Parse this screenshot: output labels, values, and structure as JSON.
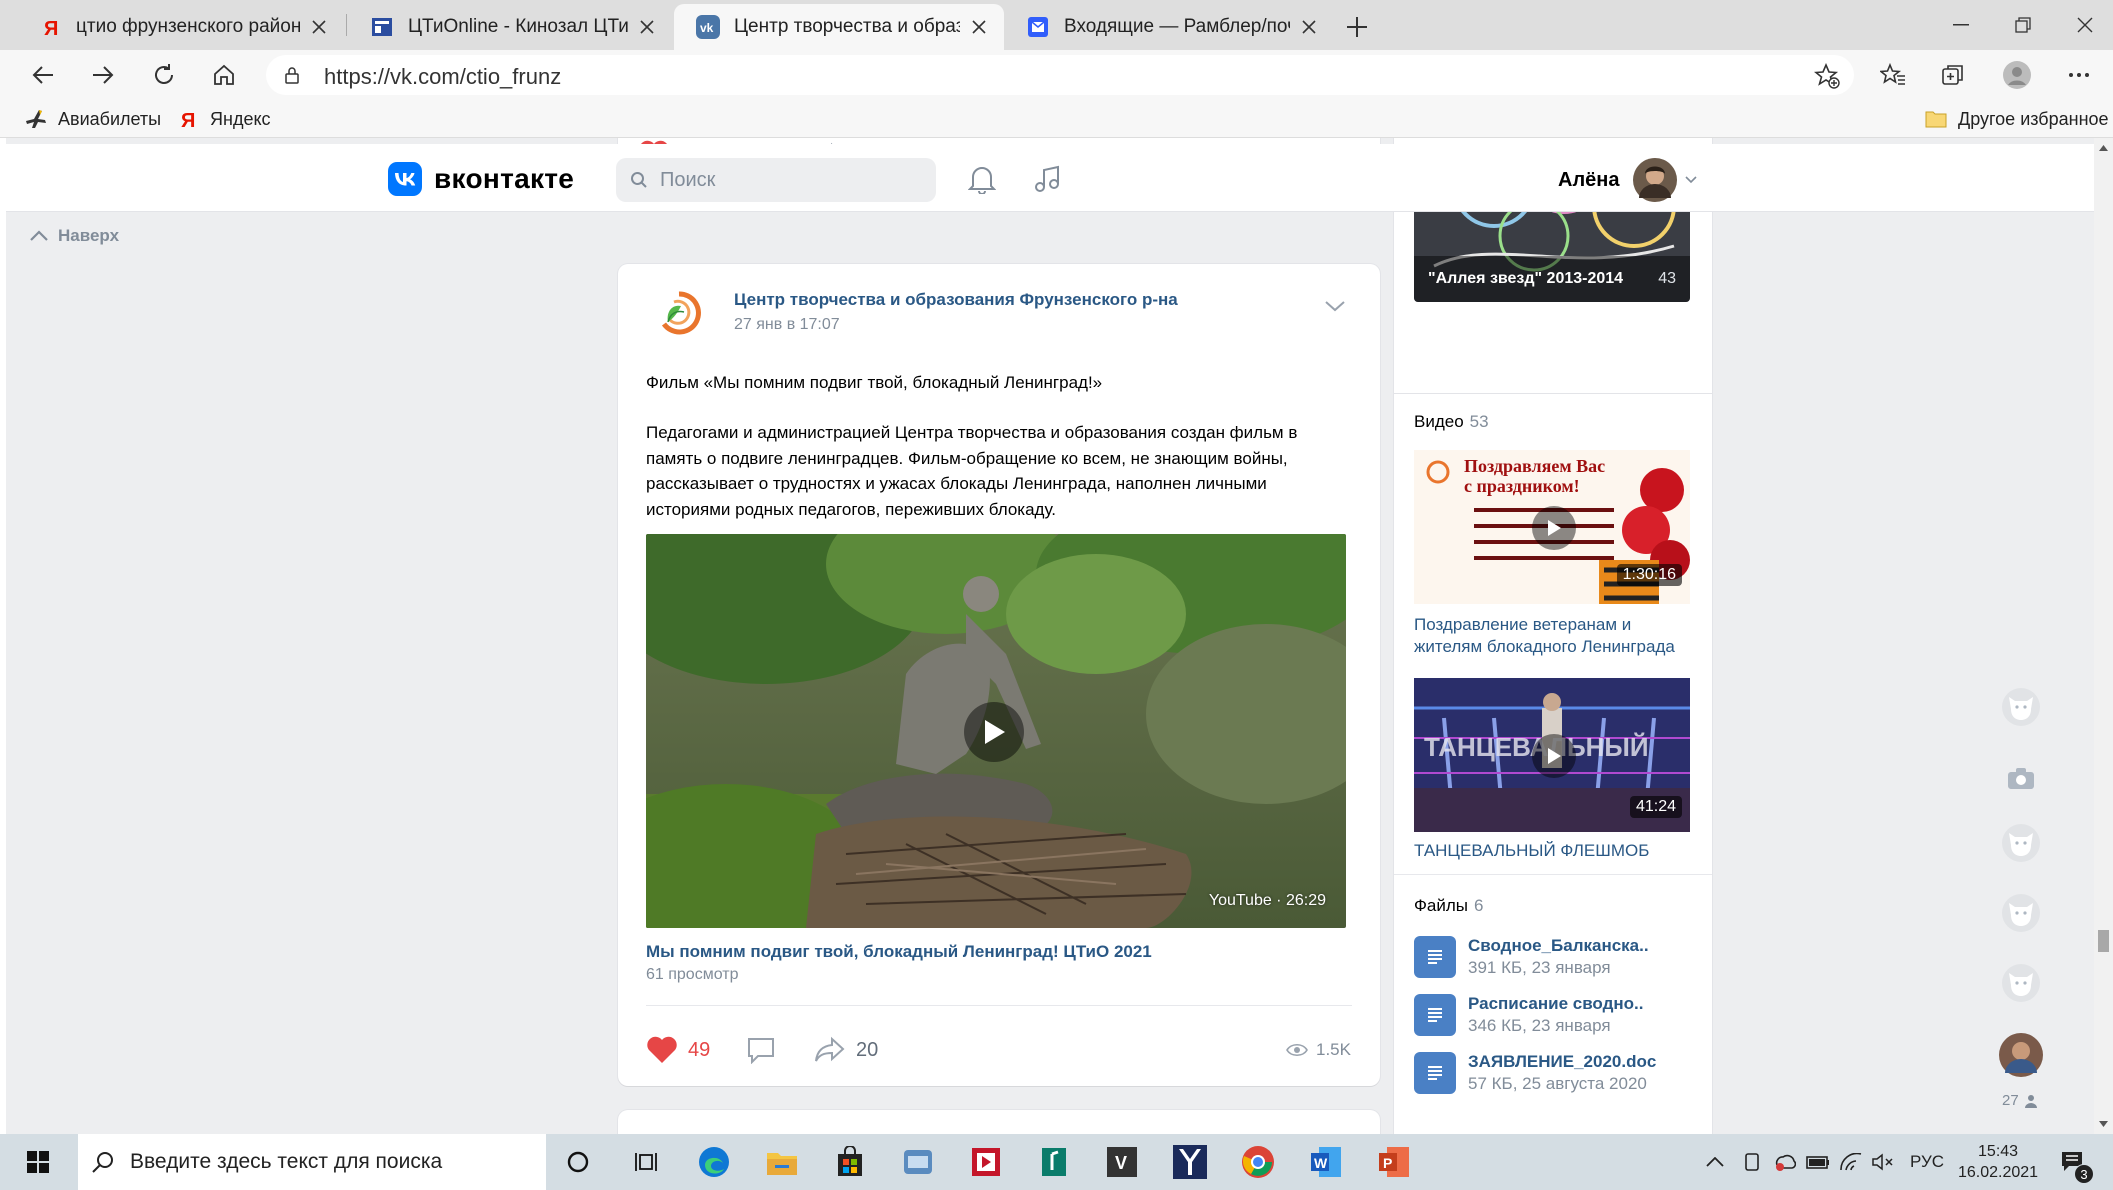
{
  "browser": {
    "tabs": [
      {
        "title": "цтио фрунзенского района оф",
        "icon": "yandex-icon",
        "active": false
      },
      {
        "title": "ЦТиOnline - Кинозал ЦТиО",
        "icon": "site-icon",
        "active": false
      },
      {
        "title": "Центр творчества и образован",
        "icon": "vk-icon",
        "active": true
      },
      {
        "title": "Входящие — Рамблер/почта",
        "icon": "mail-icon",
        "active": false
      }
    ],
    "url": "https://vk.com/ctio_frunz",
    "bookmarks": [
      {
        "label": "Авиабилеты",
        "icon": "plane-icon"
      },
      {
        "label": "Яндекс",
        "icon": "yandex-icon"
      }
    ],
    "other_favorites": "Другое избранное"
  },
  "vk": {
    "logo_text": "вконтакте",
    "search_placeholder": "Поиск",
    "user_name": "Алёна",
    "up_label": "Наверх",
    "accent": "#4a76a8"
  },
  "post": {
    "author": "Центр творчества и образования Фрунзенского р-на",
    "date": "27 янв в 17:07",
    "title_line": "Фильм «Мы помним подвиг твой, блокадный Ленинград!»",
    "body_lines": [
      "Педагогами и администрацией Центра творчества и образования создан фильм в",
      "память о подвиге ленинградцев. Фильм-обращение ко всем, не знающим войны,",
      "рассказывает о трудностях и ужасах блокады Ленинграда, наполнен личными",
      "историями родных педагогов, переживших блокаду."
    ],
    "video": {
      "badge": "YouTube · 26:29",
      "title": "Мы помним подвиг твой, блокадный Ленинград! ЦТиО 2021",
      "views": "61 просмотр"
    },
    "likes": "49",
    "shares": "20",
    "view_count": "1.5K"
  },
  "sidebar": {
    "album": {
      "caption": "\"Аллея звезд\" 2013-2014",
      "count": "43"
    },
    "videos": {
      "label": "Видео",
      "count": "53",
      "items": [
        {
          "thumb_lines": [
            "Поздравляем Вас",
            "с праздником!"
          ],
          "duration": "1:30:16",
          "title_lines": [
            "Поздравление ветеранам и",
            "жителям блокадного Ленинграда"
          ]
        },
        {
          "duration": "41:24",
          "title_lines": [
            "ТАНЦЕВАЛЬНЫЙ ФЛЕШМОБ"
          ]
        }
      ]
    },
    "files": {
      "label": "Файлы",
      "count": "6",
      "items": [
        {
          "name": "Сводное_Балканска..",
          "meta": "391 КБ, 23 января"
        },
        {
          "name": "Расписание сводно..",
          "meta": "346 КБ, 23 января"
        },
        {
          "name": "ЗАЯВЛЕНИЕ_2020.doc",
          "meta": "57 КБ, 25 августа 2020"
        }
      ]
    }
  },
  "rail": {
    "count": "27"
  },
  "taskbar": {
    "search_placeholder": "Введите здесь текст для поиска",
    "lang": "РУС",
    "time": "15:43",
    "date": "16.02.2021",
    "notifications": "3"
  }
}
